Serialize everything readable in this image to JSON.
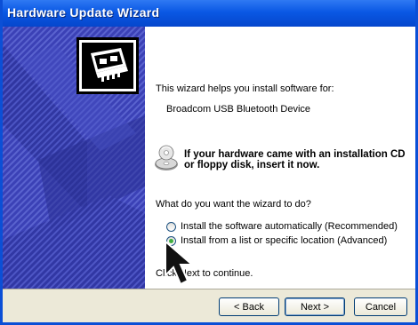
{
  "window": {
    "title": "Hardware Update Wizard"
  },
  "content": {
    "intro": "This wizard helps you install software for:",
    "device_name": "Broadcom USB Bluetooth Device",
    "cd_message_line1": "If your hardware came with an installation CD",
    "cd_message_line2": "or floppy disk, insert it now.",
    "question": "What do you want the wizard to do?",
    "options": [
      {
        "label": "Install the software automatically (Recommended)",
        "selected": false
      },
      {
        "label": "Install from a list or specific location (Advanced)",
        "selected": true
      }
    ],
    "continue_text": "Click Next to continue."
  },
  "buttons": {
    "back": "< Back",
    "next": "Next >",
    "cancel": "Cancel"
  },
  "colors": {
    "title_bar": "#0a58e4",
    "side_panel": "#3a3fb0",
    "footer": "#ece9d8"
  },
  "icons": {
    "wizard": "hardware-card-icon",
    "cd": "cd-disk-icon",
    "cursor": "mouse-pointer-icon"
  }
}
